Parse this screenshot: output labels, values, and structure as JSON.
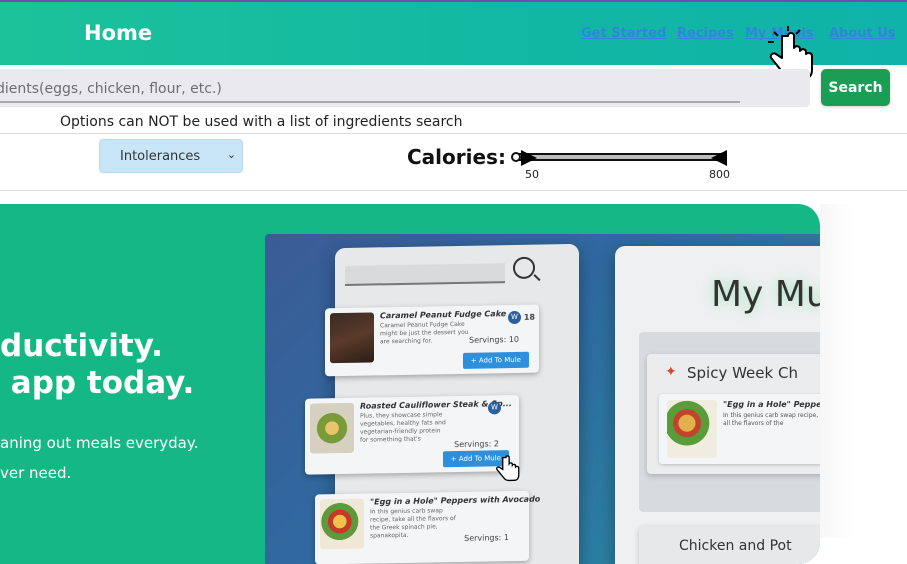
{
  "nav": {
    "brand": "Home",
    "links": [
      "Get Started",
      "Recipes",
      "My Meals",
      "About Us"
    ],
    "link_color": "#2f86d9"
  },
  "search": {
    "placeholder": "dients(eggs, chicken, flour, etc.)",
    "button_label": "Search",
    "button_color": "#1a9e55"
  },
  "options": {
    "note": "Options can NOT be used with a list of ingredients search",
    "select_value": "Intolerances",
    "calories_label": "Calories:",
    "calories_min": "50",
    "calories_max": "800"
  },
  "hero": {
    "headline_line1": "ductivity.",
    "headline_line2": " app today.",
    "body_line1": "aning out meals everyday.",
    "body_line2": "ver need.",
    "background": "#15b884"
  },
  "mockup": {
    "cards": [
      {
        "title": "Caramel Peanut Fudge Cake",
        "desc": "Caramel Peanut Fudge Cake might be just the dessert you are searching for.",
        "servings": "Servings: 10",
        "button": "+ Add To Mule",
        "count": "18"
      },
      {
        "title": "Roasted Cauliflower Steak & Sp...",
        "desc": "Plus, they showcase simple vegetables, healthy fats and vegetarian-friendly protein for something that's",
        "servings": "Servings: 2",
        "button": "+ Add To Mule",
        "count": ""
      },
      {
        "title": "\"Egg in a Hole\" Peppers with Avocado",
        "desc": "In this genius carb swap recipe, take all the flavors of the Greek spinach pie, spanakopita.",
        "servings": "Servings: 1",
        "button": "",
        "count": ""
      }
    ],
    "right_title": "My Mul",
    "right_section": "Spicy Week Ch",
    "right_inner_title": "\"Egg in a Hole\" Peppers w",
    "right_inner_desc": "In this genius carb swap recipe, take all the flavors of the",
    "right_section2": "Chicken and Pot"
  }
}
